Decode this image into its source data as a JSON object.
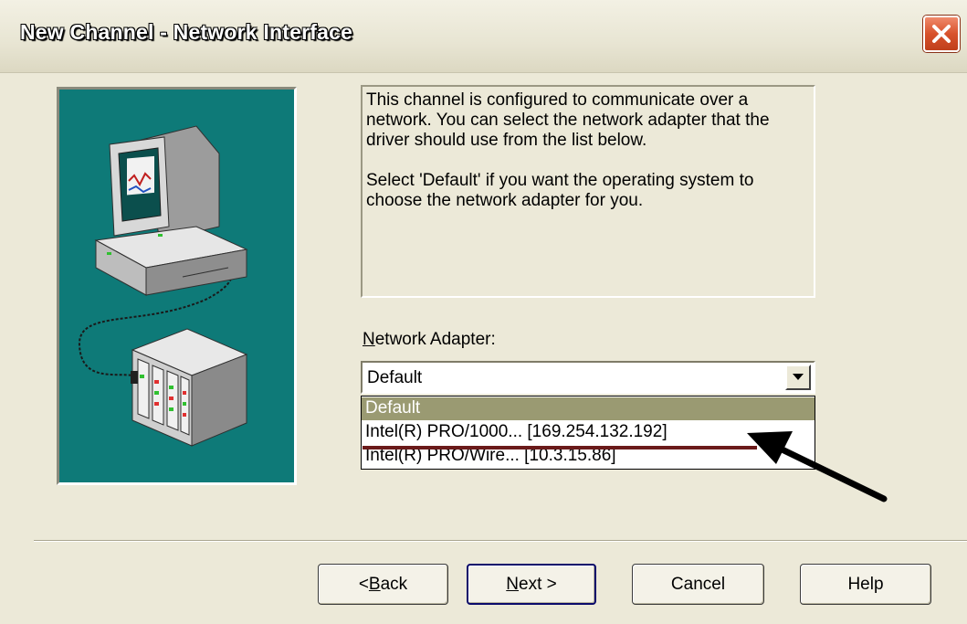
{
  "window": {
    "title": "New Channel - Network Interface"
  },
  "description": {
    "paragraph1": "This channel is configured to communicate over a network.  You can select the network adapter that the driver should use from the list below.",
    "paragraph2": "Select 'Default' if you want the operating system to choose the network adapter for you."
  },
  "network_adapter": {
    "label_mnemonic": "N",
    "label_rest": "etwork Adapter:",
    "selected_value": "Default",
    "options": [
      {
        "label": "Default",
        "highlighted": true
      },
      {
        "label": "Intel(R) PRO/1000... [169.254.132.192]",
        "highlighted": false
      },
      {
        "label": "Intel(R) PRO/Wire... [10.3.15.86]",
        "highlighted": false
      }
    ]
  },
  "buttons": {
    "back_prefix": "< ",
    "back_mnemonic": "B",
    "back_rest": "ack",
    "next_mnemonic": "N",
    "next_rest": "ext >",
    "cancel": "Cancel",
    "help": "Help"
  },
  "icons": {
    "close": "close-icon",
    "dropdown": "chevron-down-icon",
    "illustration": "computer-network-illustration",
    "annotation": "arrow-pointer-annotation"
  },
  "colors": {
    "panel_teal": "#0e7a78",
    "selection": "#9a9a72",
    "close_red": "#d8522c"
  }
}
